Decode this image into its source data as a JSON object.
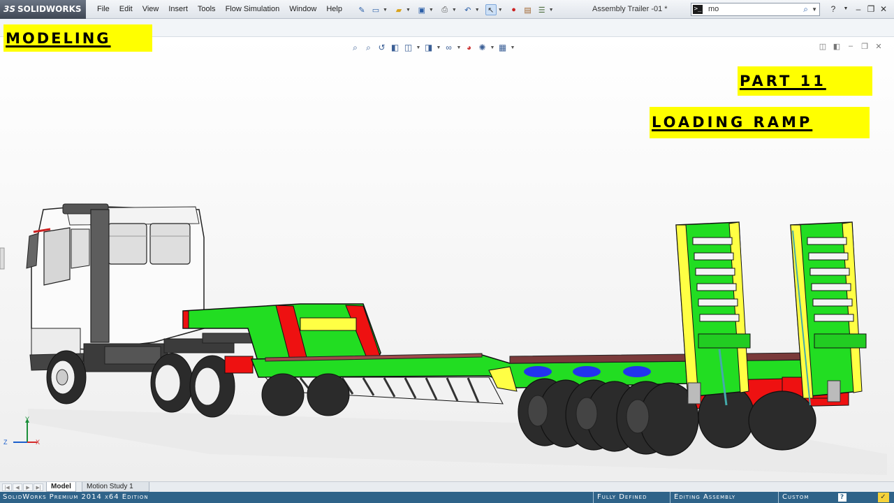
{
  "app": {
    "logo_prefix": "3S",
    "logo_text": "SOLIDWORKS",
    "document_title": "Assembly Trailer -01 *"
  },
  "menu": {
    "items": [
      "File",
      "Edit",
      "View",
      "Insert",
      "Tools",
      "Flow Simulation",
      "Window",
      "Help"
    ]
  },
  "search": {
    "prompt_symbol": ">_",
    "value": "mo"
  },
  "overlays": {
    "modeling": "MODELING",
    "part": "PART 11",
    "loading_ramp": "LOADING RAMP"
  },
  "triad": {
    "y": "Y",
    "z": "Z",
    "x": "X"
  },
  "tabs": {
    "model": "Model",
    "motion": "Motion Study 1"
  },
  "status": {
    "edition": "SolidWorks Premium 2014 x64 Edition",
    "defined": "Fully Defined",
    "editing": "Editing Assembly",
    "units": "Custom",
    "help": "?"
  },
  "icons": {
    "hud": [
      "zoom-to-fit-icon",
      "zoom-area-icon",
      "previous-view-icon",
      "section-view-icon",
      "view-orientation-icon",
      "display-style-icon",
      "hide-show-icon",
      "edit-appearance-icon",
      "apply-scene-icon",
      "view-settings-icon"
    ]
  },
  "colors": {
    "status_bar": "#2f6389",
    "highlight_yellow": "#ffff00",
    "trailer_green": "#22dd22",
    "trailer_red": "#ee1111"
  }
}
